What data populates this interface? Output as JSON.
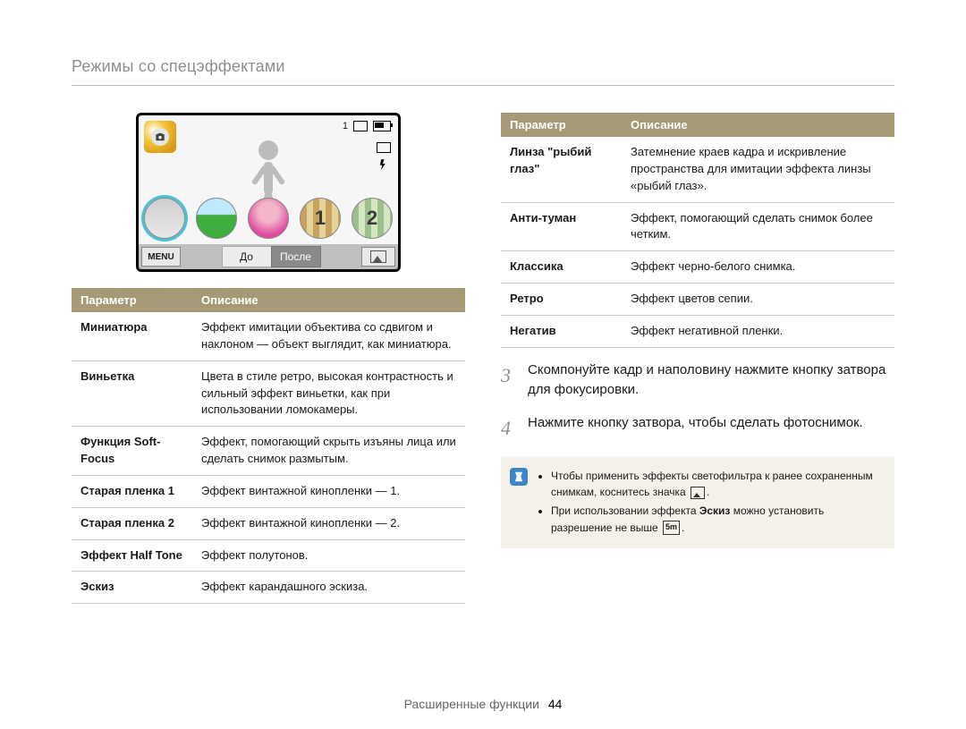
{
  "page_title": "Режимы со спецэффектами",
  "footer": {
    "section": "Расширенные функции",
    "page": "44"
  },
  "screen": {
    "corner_badge": "camera",
    "status": {
      "count": "1"
    },
    "before": "До",
    "after": "После",
    "menu": "MENU",
    "thumbs": [
      "selected",
      "green",
      "face",
      "num1",
      "num2"
    ],
    "thumb_nums": {
      "num1": "1",
      "num2": "2"
    }
  },
  "tableLeft": {
    "head": {
      "param": "Параметр",
      "desc": "Описание"
    },
    "rows": [
      {
        "name": "Миниатюра",
        "desc": "Эффект имитации объектива со сдвигом и наклоном — объект выглядит, как миниатюра."
      },
      {
        "name": "Виньетка",
        "desc": "Цвета в стиле ретро, высокая контрастность и сильный эффект виньетки, как при использовании ломокамеры."
      },
      {
        "name": "Функция Soft-Focus",
        "desc": "Эффект, помогающий скрыть изъяны лица или сделать снимок размытым."
      },
      {
        "name": "Старая пленка 1",
        "desc": "Эффект винтажной кинопленки — 1."
      },
      {
        "name": "Старая пленка 2",
        "desc": "Эффект винтажной кинопленки — 2."
      },
      {
        "name": "Эффект Half Tone",
        "desc": "Эффект полутонов."
      },
      {
        "name": "Эскиз",
        "desc": "Эффект карандашного эскиза."
      }
    ]
  },
  "tableRight": {
    "head": {
      "param": "Параметр",
      "desc": "Описание"
    },
    "rows": [
      {
        "name": "Линза \"рыбий глаз\"",
        "desc": "Затемнение краев кадра и искривление пространства для имитации эффекта линзы «рыбий глаз»."
      },
      {
        "name": "Анти-туман",
        "desc": "Эффект, помогающий сделать снимок более четким."
      },
      {
        "name": "Классика",
        "desc": "Эффект черно-белого снимка."
      },
      {
        "name": "Ретро",
        "desc": "Эффект цветов сепии."
      },
      {
        "name": "Негатив",
        "desc": "Эффект негативной пленки."
      }
    ]
  },
  "steps": {
    "s3_num": "3",
    "s3": "Скомпонуйте кадр и наполовину нажмите кнопку затвора для фокусировки.",
    "s4_num": "4",
    "s4": "Нажмите кнопку затвора, чтобы сделать фотоснимок."
  },
  "note": {
    "item1a": "Чтобы применить эффекты светофильтра к ранее сохраненным снимкам, коснитесь значка",
    "item1b": ".",
    "item2a": "При использовании эффекта ",
    "item2bold": "Эскиз",
    "item2b": " можно установить разрешение не выше",
    "item2c": "."
  },
  "icons": {
    "res_5m": "5m"
  }
}
